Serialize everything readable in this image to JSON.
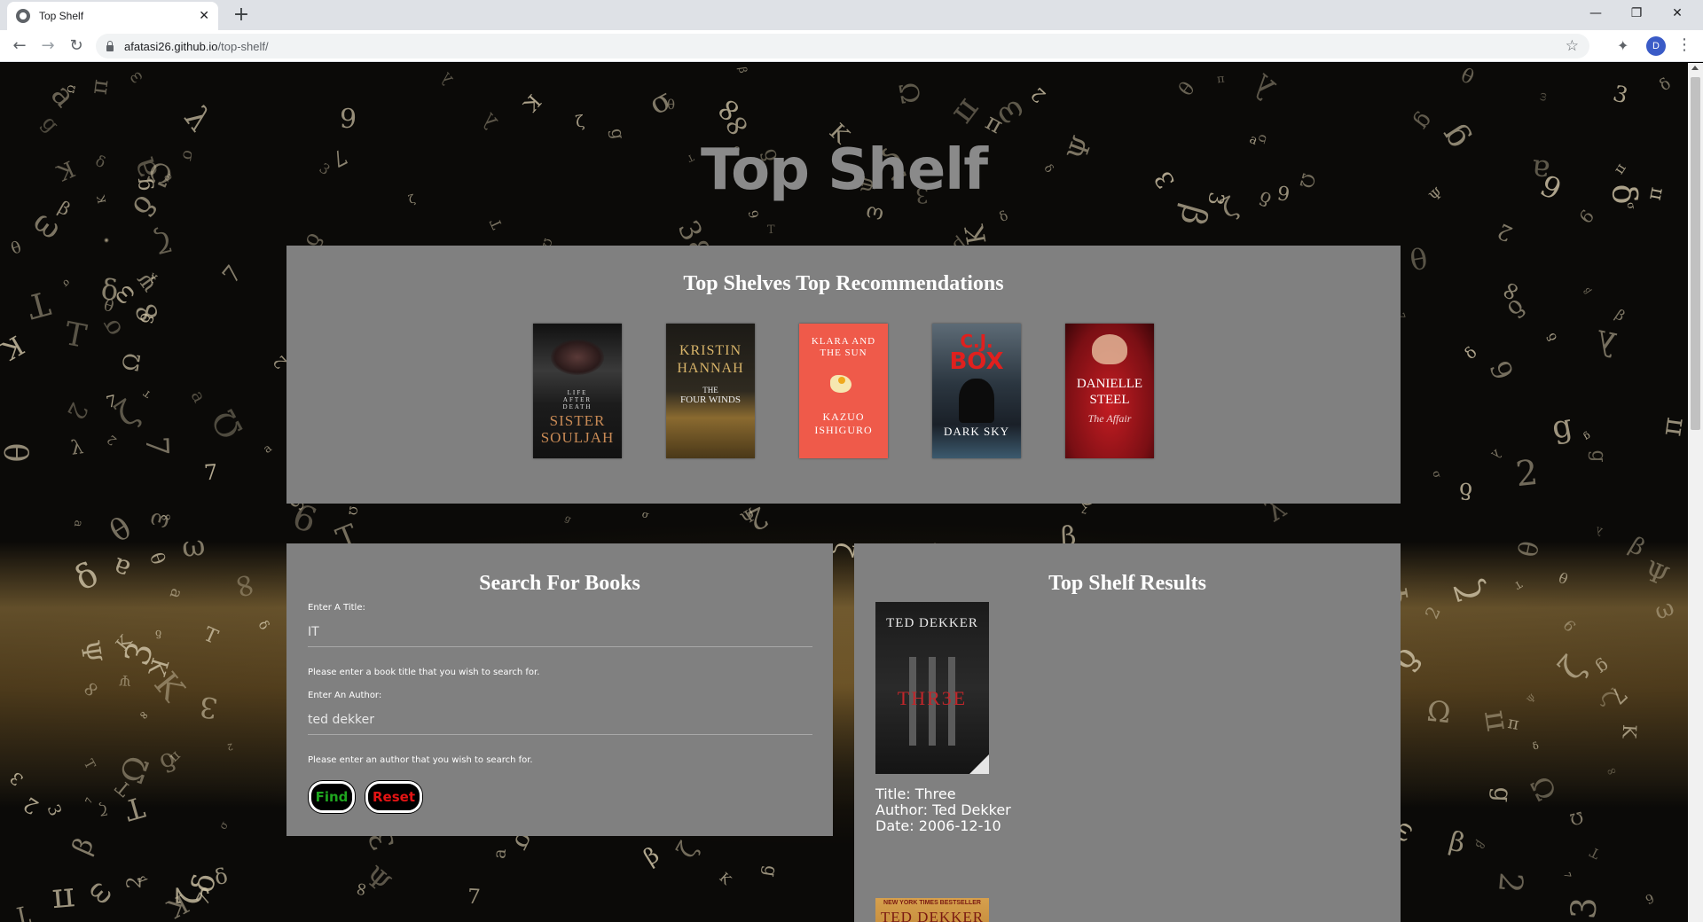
{
  "browser": {
    "tab_title": "Top Shelf",
    "close_glyph": "✕",
    "new_tab_glyph": "+",
    "url_host": "afatasi26.github.io",
    "url_path": "/top-shelf/",
    "profile_initial": "D",
    "window_controls": {
      "minimize": "—",
      "restore": "❐",
      "close": "✕"
    },
    "nav": {
      "back": "←",
      "forward": "→",
      "reload": "↻"
    },
    "icons": {
      "star": "☆",
      "extensions": "✦",
      "menu": "⋮"
    }
  },
  "site": {
    "title": "Top Shelf"
  },
  "recommendations": {
    "heading": "Top Shelves Top Recommendations",
    "books": [
      {
        "cover_lines": [
          "LIFE",
          "AFTER",
          "DEATH",
          "SISTER",
          "SOULJAH"
        ],
        "bg": "#2a2a2a",
        "accent": "#c88a55"
      },
      {
        "cover_lines": [
          "KRISTIN",
          "HANNAH",
          "THE",
          "FOUR WINDS"
        ],
        "bg": "#2b261c",
        "accent": "#d9b56a"
      },
      {
        "cover_lines": [
          "KLARA AND",
          "THE SUN",
          "KAZUO",
          "ISHIGURO"
        ],
        "bg": "#ef5a4a",
        "accent": "#ffffff"
      },
      {
        "cover_lines": [
          "C.J.",
          "BOX",
          "DARK SKY"
        ],
        "bg": "#1e2a33",
        "accent": "#e0201e"
      },
      {
        "cover_lines": [
          "DANIELLE",
          "STEEL",
          "The Affair"
        ],
        "bg": "#a2121b",
        "accent": "#ffffff"
      }
    ]
  },
  "search": {
    "heading": "Search For Books",
    "title_label": "Enter A Title:",
    "title_value": "IT",
    "title_hint": "Please enter a book title that you wish to search for.",
    "author_label": "Enter An Author:",
    "author_value": "ted dekker",
    "author_hint": "Please enter an author that you wish to search for.",
    "find_label": "Find",
    "reset_label": "Reset"
  },
  "results": {
    "heading": "Top Shelf Results",
    "items": [
      {
        "cover_author": "TED DEKKER",
        "cover_title": "THR3E",
        "title_line": "Title: Three",
        "author_line": "Author: Ted Dekker",
        "date_line": "Date: 2006-12-10"
      },
      {
        "cover_top": "NEW YORK TIMES BESTSELLER",
        "cover_author": "TED DEKKER"
      }
    ]
  }
}
